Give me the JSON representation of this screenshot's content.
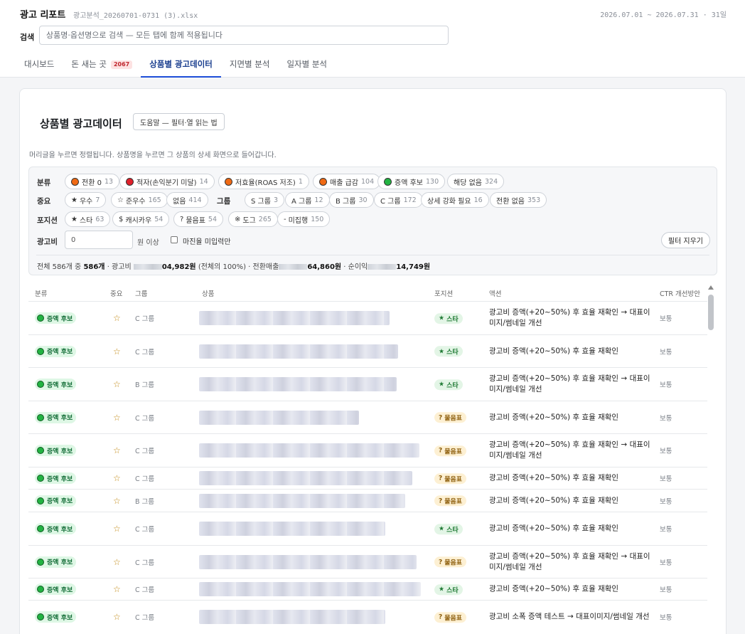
{
  "header": {
    "title": "광고 리포트",
    "file_name": "광고분석_20260701-0731 (3).xlsx",
    "date_range": "2026.07.01 ~ 2026.07.31 · 31일",
    "search_label": "검색",
    "search_placeholder": "상품명·옵션명으로 검색 — 모든 탭에 함께 적용됩니다"
  },
  "tabs": [
    {
      "label": "대시보드"
    },
    {
      "label": "돈 새는 곳",
      "badge": "2067"
    },
    {
      "label": "상품별 광고데이터",
      "active": true
    },
    {
      "label": "지면별 분석"
    },
    {
      "label": "일자별 분석"
    }
  ],
  "section": {
    "title": "상품별 광고데이터",
    "help_button": "도움말 — 필터·열 읽는 법",
    "help_text": "머리글을 누르면 정렬됩니다. 상품명을 누르면 그 상품의 상세 화면으로 들어갑니다."
  },
  "filters": {
    "category_label": "분류",
    "category_chips": [
      {
        "label": "전환 0",
        "count": "13",
        "color": "#f06a14"
      },
      {
        "label": "적자(손익분기 미달)",
        "count": "14",
        "color": "#e0202a"
      },
      {
        "label": "저효율(ROAS 저조)",
        "count": "1",
        "color": "#f06a14"
      },
      {
        "label": "매출 급감",
        "count": "104",
        "color": "#f06a14"
      },
      {
        "label": "증액 후보",
        "count": "130",
        "color": "#22b342"
      },
      {
        "label": "해당 없음",
        "count": "324"
      }
    ],
    "importance_label": "중요",
    "importance_chips": [
      {
        "label": "우수",
        "count": "7",
        "symbol": "★"
      },
      {
        "label": "준우수",
        "count": "165",
        "symbol": "☆"
      },
      {
        "label": "없음",
        "count": "414"
      }
    ],
    "group_label": "그룹",
    "group_chips": [
      {
        "label": "S 그룹",
        "count": "3"
      },
      {
        "label": "A 그룹",
        "count": "12"
      },
      {
        "label": "B 그룹",
        "count": "30"
      },
      {
        "label": "C 그룹",
        "count": "172"
      },
      {
        "label": "상세 강화 필요",
        "count": "16"
      },
      {
        "label": "전환 없음",
        "count": "353"
      }
    ],
    "position_label": "포지션",
    "position_chips": [
      {
        "label": "스타",
        "count": "63",
        "symbol": "★"
      },
      {
        "label": "캐시카우",
        "count": "54",
        "symbol": "$"
      },
      {
        "label": "물음표",
        "count": "54",
        "symbol": "?"
      },
      {
        "label": "도그",
        "count": "265",
        "symbol": "※"
      },
      {
        "label": "미집행",
        "count": "150",
        "symbol": "-"
      }
    ],
    "ad_cost_label": "광고비",
    "ad_cost_value": "0",
    "ad_cost_suffix": "원 이상",
    "margin_label": "마진율 미입력만",
    "clear_button": "필터 지우기"
  },
  "summary": {
    "prefix": "전체 586개 중 ",
    "shown": "586개",
    "ad_label": " · 광고비 ",
    "ad_value": "04,982원",
    "ad_share": " (전체의 100%) · 전환매출",
    "sales_value": "64,860원",
    "profit_label": " · 순이익",
    "profit_value": "14,749원"
  },
  "table": {
    "columns": [
      "분류",
      "중요",
      "그룹",
      "상품",
      "포지션",
      "액션",
      "CTR 개선방안"
    ],
    "rows": [
      {
        "category": "증액 후보",
        "importance": "☆",
        "group": "C 그룹",
        "position": "스타",
        "action": "광고비 증액(+20~50%) 후 효율 재확인 → 대표이미지/썸네일 개선",
        "ctr": "보통"
      },
      {
        "category": "증액 후보",
        "importance": "☆",
        "group": "C 그룹",
        "position": "스타",
        "action": "광고비 증액(+20~50%) 후 효율 재확인",
        "ctr": "보통"
      },
      {
        "category": "증액 후보",
        "importance": "☆",
        "group": "B 그룹",
        "position": "스타",
        "action": "광고비 증액(+20~50%) 후 효율 재확인 → 대표이미지/썸네일 개선",
        "ctr": "보통"
      },
      {
        "category": "증액 후보",
        "importance": "☆",
        "group": "C 그룹",
        "position": "물음표",
        "action": "광고비 증액(+20~50%) 후 효율 재확인",
        "ctr": "보통"
      },
      {
        "category": "증액 후보",
        "importance": "☆",
        "group": "C 그룹",
        "position": "물음표",
        "action": "광고비 증액(+20~50%) 후 효율 재확인 → 대표이미지/썸네일 개선",
        "ctr": "보통"
      },
      {
        "category": "증액 후보",
        "importance": "☆",
        "group": "C 그룹",
        "position": "물음표",
        "action": "광고비 증액(+20~50%) 후 효율 재확인",
        "ctr": "보통"
      },
      {
        "category": "증액 후보",
        "importance": "☆",
        "group": "B 그룹",
        "position": "물음표",
        "action": "광고비 증액(+20~50%) 후 효율 재확인",
        "ctr": "보통"
      },
      {
        "category": "증액 후보",
        "importance": "☆",
        "group": "C 그룹",
        "position": "스타",
        "action": "광고비 증액(+20~50%) 후 효율 재확인",
        "ctr": "보통"
      },
      {
        "category": "증액 후보",
        "importance": "☆",
        "group": "C 그룹",
        "position": "물음표",
        "action": "광고비 증액(+20~50%) 후 효율 재확인 → 대표이미지/썸네일 개선",
        "ctr": "보통"
      },
      {
        "category": "증액 후보",
        "importance": "☆",
        "group": "C 그룹",
        "position": "스타",
        "action": "광고비 증액(+20~50%) 후 효율 재확인",
        "ctr": "보통"
      },
      {
        "category": "증액 후보",
        "importance": "☆",
        "group": "C 그룹",
        "position": "물음표",
        "action": "광고비 소폭 증액 테스트 → 대표이미지/썸네일 개선",
        "ctr": "보통"
      }
    ]
  }
}
